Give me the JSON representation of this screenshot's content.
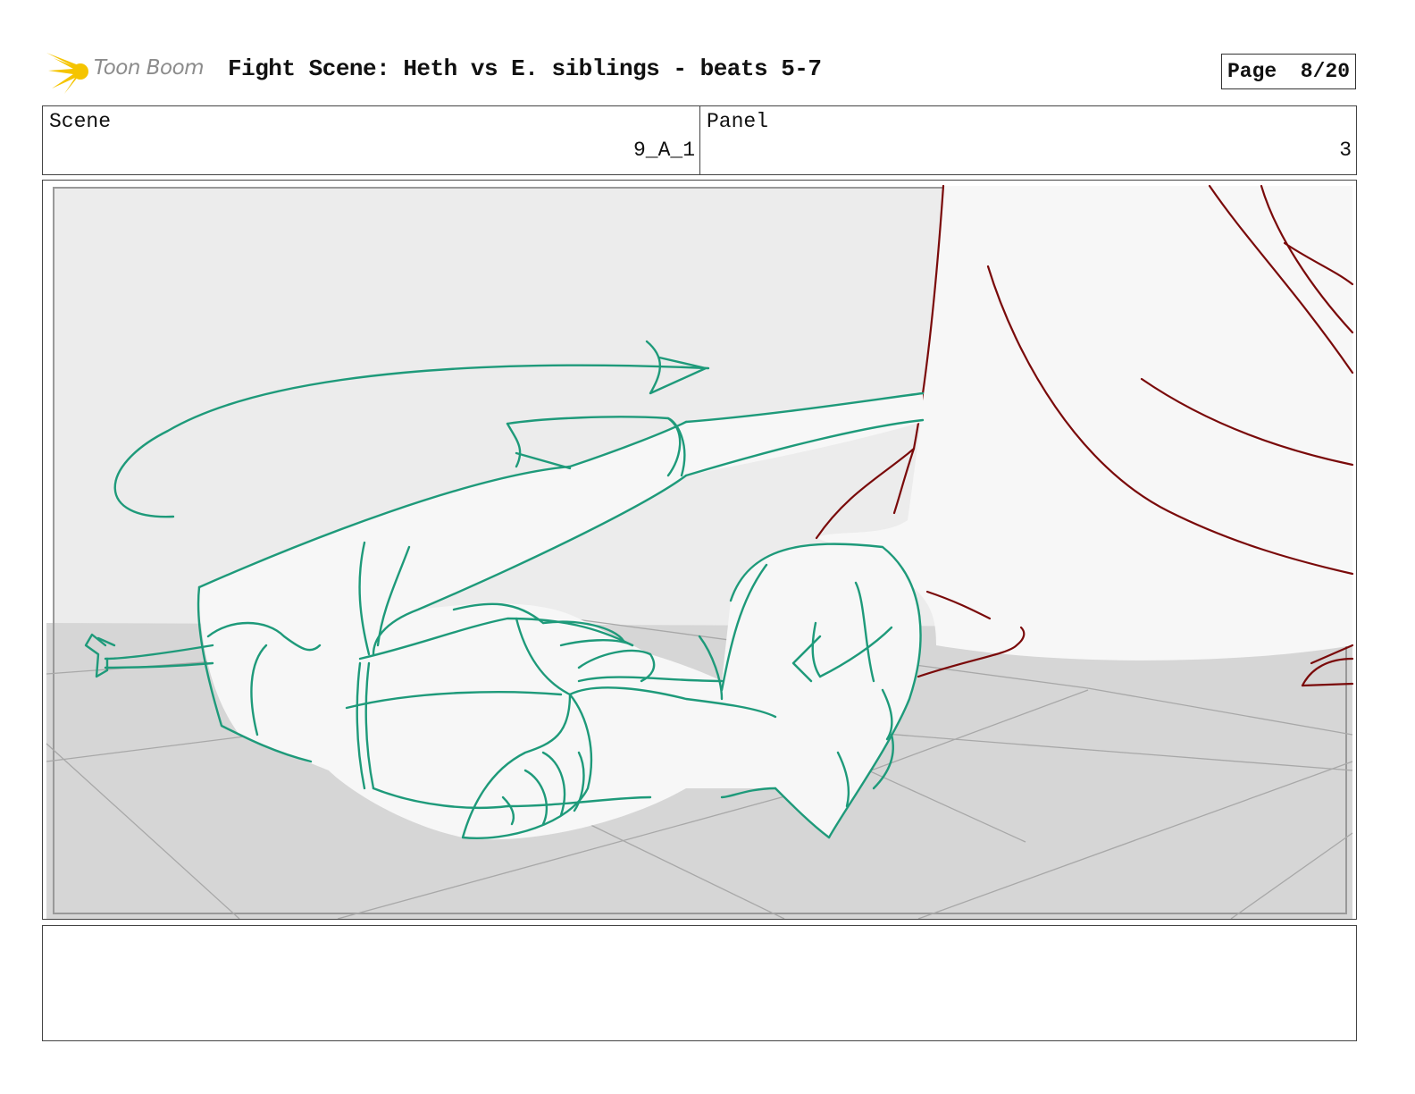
{
  "header": {
    "logo_text": "Toon Boom",
    "title": "Fight Scene: Heth vs E. siblings - beats 5-7",
    "page_label": "Page",
    "page_value": "8/20"
  },
  "info": {
    "scene_label": "Scene",
    "scene_value": "9_A_1",
    "panel_label": "Panel",
    "panel_value": "3"
  },
  "colors": {
    "sketch_green": "#1e9a7a",
    "sketch_red": "#7a0a0a",
    "wall": "#ececec",
    "floor": "#d6d6d6"
  },
  "notes": {
    "text": ""
  }
}
